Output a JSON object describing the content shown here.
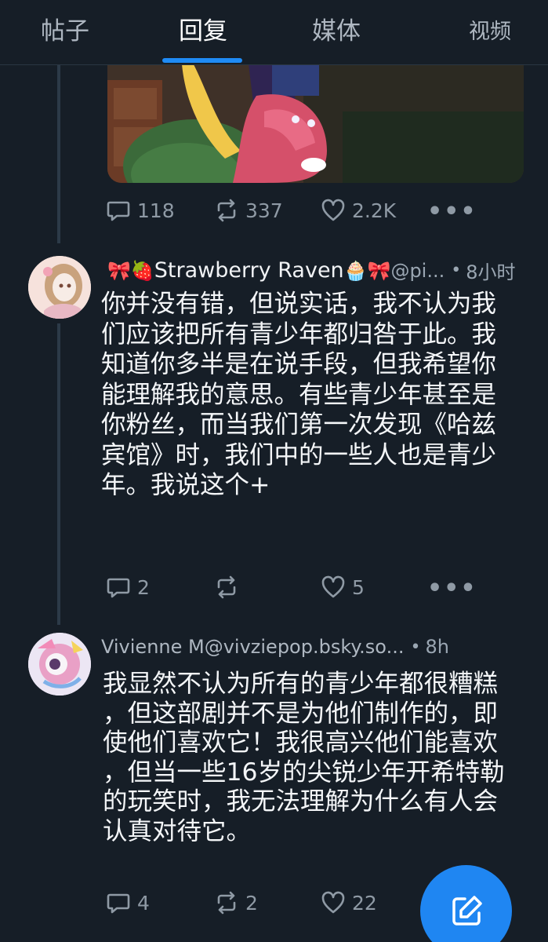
{
  "tabs": [
    {
      "label": "帖子"
    },
    {
      "label": "回复"
    },
    {
      "label": "媒体"
    },
    {
      "label": "视频"
    }
  ],
  "active_tab": "回复",
  "top_post": {
    "replies": "118",
    "reposts": "337",
    "likes": "2.2K"
  },
  "post1": {
    "name_prefix": "🎀🍓",
    "name": "Strawberry Raven",
    "name_suffix": "🧁🎀",
    "handle": "@pi...",
    "sep": "•",
    "time": "8小时",
    "lines": [
      "你并没有错，但说实话，我不认为我",
      "们应该把所有青少年都归咎于此。我",
      "知道你多半是在说手段，但我希望你",
      "能理解我的意思。有些青少年甚至是",
      "你粉丝，而当我们第一次发现《哈兹",
      "宾馆》时，我们中的一些人也是青少",
      "年。我说这个+"
    ],
    "replies": "2",
    "reposts": "",
    "likes": "5"
  },
  "post2": {
    "name": "Vivienne M",
    "handle": "@vivziepop.bsky.so...",
    "sep": "•",
    "time": "8h",
    "lines": [
      "我显然不认为所有的青少年都很糟糕",
      "，但这部剧并不是为他们制作的，即",
      "使他们喜欢它！我很高兴他们能喜欢",
      "，但当一些16岁的尖锐少年开希特勒",
      "的玩笑时，我无法理解为什么有人会",
      "认真对待它。"
    ],
    "replies": "4",
    "reposts": "2",
    "likes": "22"
  },
  "icons": {
    "reply": "speech-bubble-icon",
    "repost": "repost-arrows-icon",
    "like": "heart-icon",
    "more": "more-dots-icon",
    "compose": "compose-pencil-icon"
  },
  "colors": {
    "background": "#161e27",
    "accent": "#1f8bf5",
    "muted": "#8f9aa5"
  }
}
